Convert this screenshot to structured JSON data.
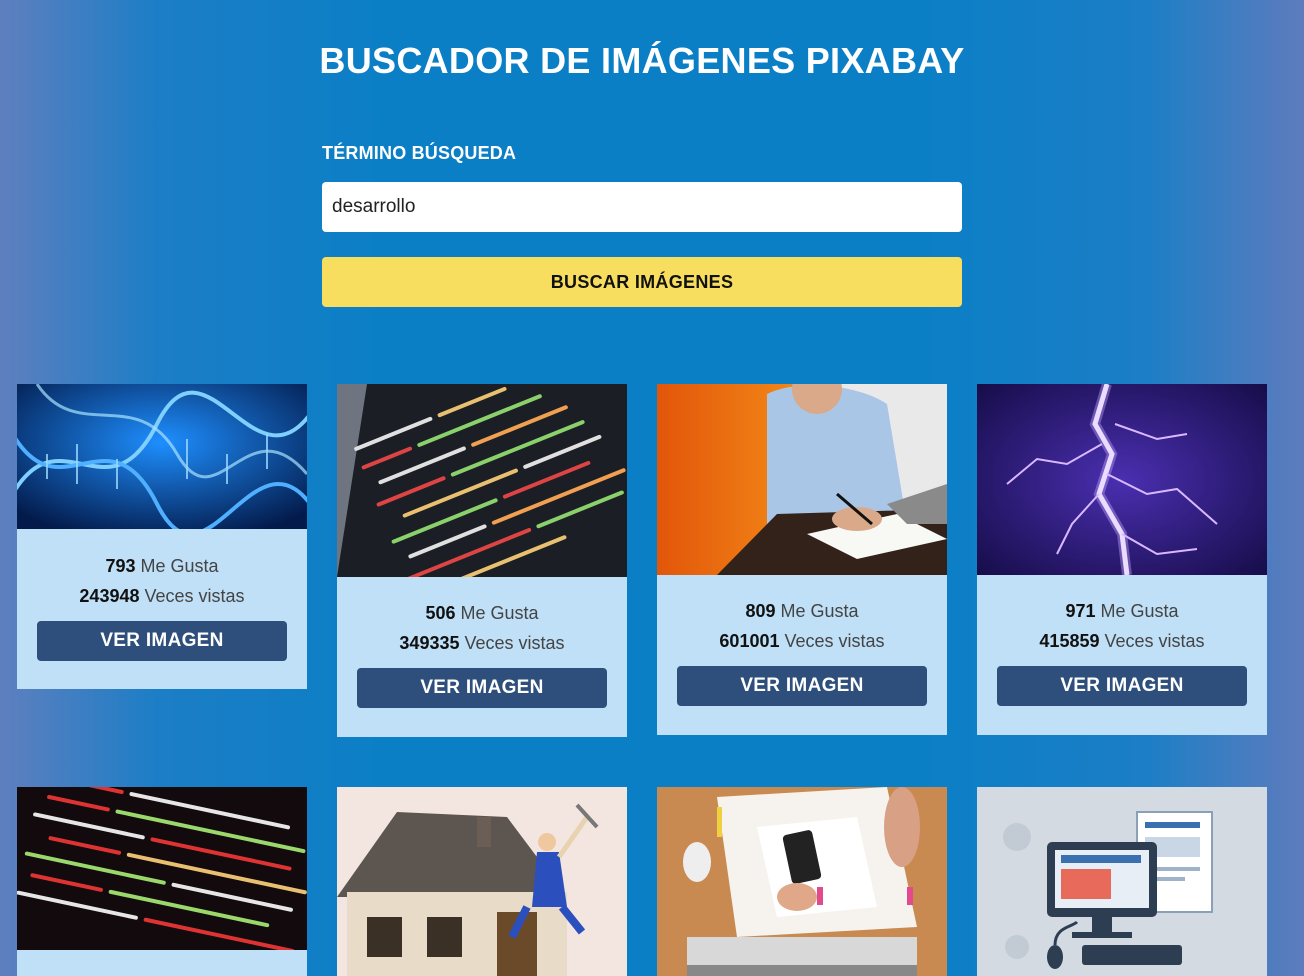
{
  "header": {
    "title": "BUSCADOR DE IMÁGENES PIXABAY"
  },
  "search": {
    "label": "TÉRMINO BÚSQUEDA",
    "value": "desarrollo",
    "button_label": "BUSCAR IMÁGENES"
  },
  "results": [
    {
      "likes": "793",
      "likes_label": "Me Gusta",
      "views": "243948",
      "views_label": "Veces vistas",
      "button_label": "VER IMAGEN",
      "image": "dna-helix"
    },
    {
      "likes": "506",
      "likes_label": "Me Gusta",
      "views": "349335",
      "views_label": "Veces vistas",
      "button_label": "VER IMAGEN",
      "image": "code-screen"
    },
    {
      "likes": "809",
      "likes_label": "Me Gusta",
      "views": "601001",
      "views_label": "Veces vistas",
      "button_label": "VER IMAGEN",
      "image": "man-writing-laptop"
    },
    {
      "likes": "971",
      "likes_label": "Me Gusta",
      "views": "415859",
      "views_label": "Veces vistas",
      "button_label": "VER IMAGEN",
      "image": "lightning"
    },
    {
      "image": "code-lines"
    },
    {
      "image": "house-jumping-worker"
    },
    {
      "image": "desk-phone-papers"
    },
    {
      "image": "computer-illustration"
    }
  ],
  "colors": {
    "accent": "#f8de5f",
    "button": "#2e4f7c",
    "card": "#bfe0f7",
    "background": "#0a7fc6"
  }
}
